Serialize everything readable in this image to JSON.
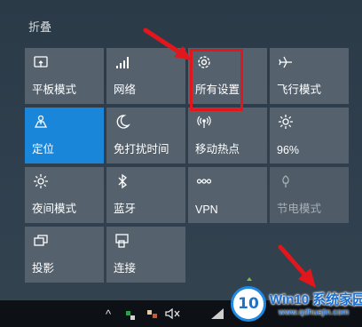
{
  "action_center": {
    "collapse_label": "折叠",
    "tiles": [
      {
        "label": "平板模式",
        "icon": "tablet-mode-icon",
        "state": "off"
      },
      {
        "label": "网络",
        "icon": "network-icon",
        "state": "off"
      },
      {
        "label": "所有设置",
        "icon": "settings-gear-icon",
        "state": "off",
        "highlighted": true
      },
      {
        "label": "飞行模式",
        "icon": "airplane-icon",
        "state": "off"
      },
      {
        "label": "定位",
        "icon": "location-icon",
        "state": "on"
      },
      {
        "label": "免打扰时间",
        "icon": "moon-icon",
        "state": "off"
      },
      {
        "label": "移动热点",
        "icon": "hotspot-icon",
        "state": "off"
      },
      {
        "label": "96%",
        "icon": "brightness-icon",
        "state": "off"
      },
      {
        "label": "夜间模式",
        "icon": "night-light-icon",
        "state": "off"
      },
      {
        "label": "蓝牙",
        "icon": "bluetooth-icon",
        "state": "off"
      },
      {
        "label": "VPN",
        "icon": "vpn-icon",
        "state": "off"
      },
      {
        "label": "节电模式",
        "icon": "battery-saver-icon",
        "state": "disabled"
      },
      {
        "label": "投影",
        "icon": "project-icon",
        "state": "off"
      },
      {
        "label": "连接",
        "icon": "connect-icon",
        "state": "off"
      }
    ]
  },
  "taskbar": {
    "tray_overflow": "^",
    "mute_icon": "speaker-muted-icon",
    "wifi_icon": "wifi-icon"
  },
  "watermark": {
    "badge": "10",
    "title": "Win10 系统家园",
    "url": "www.qdhuajin.com"
  },
  "colors": {
    "tile": "#55626d",
    "tile_active": "#1a86d9",
    "highlight_box": "#e2161d",
    "annotation_arrow": "#e2161d"
  }
}
